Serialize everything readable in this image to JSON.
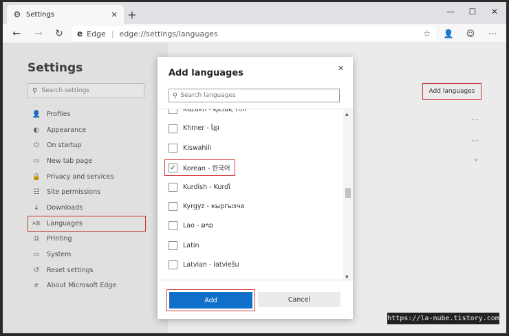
{
  "tab": {
    "title": "Settings",
    "icon": "gear-icon"
  },
  "window": {
    "minimize": "—",
    "maximize": "☐",
    "close": "✕"
  },
  "address": {
    "brand": "Edge",
    "separator": "|",
    "url": "edge://settings/languages"
  },
  "sidebar": {
    "title": "Settings",
    "search_placeholder": "Search settings",
    "items": [
      {
        "label": "Profiles",
        "icon": "profile-icon"
      },
      {
        "label": "Appearance",
        "icon": "appearance-icon"
      },
      {
        "label": "On startup",
        "icon": "power-icon"
      },
      {
        "label": "New tab page",
        "icon": "newtab-icon"
      },
      {
        "label": "Privacy and services",
        "icon": "lock-icon"
      },
      {
        "label": "Site permissions",
        "icon": "permissions-icon"
      },
      {
        "label": "Downloads",
        "icon": "download-icon"
      },
      {
        "label": "Languages",
        "icon": "languages-icon",
        "active": true
      },
      {
        "label": "Printing",
        "icon": "printer-icon"
      },
      {
        "label": "System",
        "icon": "system-icon"
      },
      {
        "label": "Reset settings",
        "icon": "reset-icon"
      },
      {
        "label": "About Microsoft Edge",
        "icon": "edge-icon"
      }
    ]
  },
  "main": {
    "add_languages_label": "Add languages"
  },
  "dialog": {
    "title": "Add languages",
    "search_placeholder": "Search languages",
    "languages": [
      {
        "label": "Kazakh - қазақ тілі",
        "checked": false
      },
      {
        "label": "Khmer - ខ្មែរ",
        "checked": false
      },
      {
        "label": "Kiswahili",
        "checked": false
      },
      {
        "label": "Korean - 한국어",
        "checked": true
      },
      {
        "label": "Kurdish - Kurdî",
        "checked": false
      },
      {
        "label": "Kyrgyz - кыргызча",
        "checked": false
      },
      {
        "label": "Lao - ລາວ",
        "checked": false
      },
      {
        "label": "Latin",
        "checked": false
      },
      {
        "label": "Latvian - latviešu",
        "checked": false
      }
    ],
    "add_label": "Add",
    "cancel_label": "Cancel"
  },
  "watermark": "https://la-nube.tistory.com",
  "colors": {
    "accent": "#0f6fc9",
    "highlight": "#d53a3a"
  }
}
